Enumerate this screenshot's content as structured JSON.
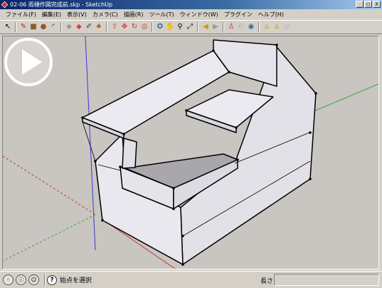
{
  "window": {
    "title": "02-06 雨樋作図完成前.skp - SketchUp",
    "buttons": [
      "_",
      "□",
      "X"
    ]
  },
  "menu": [
    "ファイル(F)",
    "編集(E)",
    "表示(V)",
    "カメラ(C)",
    "描画(R)",
    "ツール(T)",
    "ウィンドウ(W)",
    "プラグイン",
    "ヘルプ(H)"
  ],
  "toolbar": {
    "tools": [
      {
        "name": "select-icon",
        "glyph": "↖"
      },
      {
        "name": "pencil-icon",
        "glyph": "✎"
      },
      {
        "name": "rectangle-icon",
        "glyph": "■"
      },
      {
        "name": "circle-icon",
        "glyph": "●"
      },
      {
        "name": "arc-icon",
        "glyph": "◜"
      },
      {
        "name": "make-component-icon",
        "glyph": "◈"
      },
      {
        "name": "eraser-icon",
        "glyph": "◆"
      },
      {
        "name": "tape-measure-icon",
        "glyph": "✐"
      },
      {
        "name": "paint-bucket-icon",
        "glyph": "♠"
      },
      {
        "name": "push-pull-icon",
        "glyph": "⇧"
      },
      {
        "name": "move-icon",
        "glyph": "✥"
      },
      {
        "name": "rotate-icon",
        "glyph": "↻"
      },
      {
        "name": "offset-icon",
        "glyph": "◎"
      },
      {
        "name": "orbit-icon",
        "glyph": "✪"
      },
      {
        "name": "pan-icon",
        "glyph": "✋"
      },
      {
        "name": "zoom-icon",
        "glyph": "⚲"
      },
      {
        "name": "zoom-extents-icon",
        "glyph": "⤢"
      },
      {
        "name": "previous-view-icon",
        "glyph": "◀"
      },
      {
        "name": "next-view-icon",
        "glyph": "▶"
      },
      {
        "name": "position-camera-icon",
        "glyph": "♙"
      },
      {
        "name": "walk-icon",
        "glyph": "♘"
      },
      {
        "name": "look-around-icon",
        "glyph": "◉"
      },
      {
        "name": "get-models-icon",
        "glyph": "⌂"
      },
      {
        "name": "share-model-icon",
        "glyph": "⌂"
      },
      {
        "name": "google-earth-icon",
        "glyph": "◍"
      }
    ]
  },
  "status": {
    "icons": [
      "geo-location-icon",
      "credits-icon",
      "user-icon"
    ],
    "help_glyph": "?",
    "message": "始点を選択",
    "length_label": "長さ",
    "length_value": ""
  },
  "overlay": {
    "play_button": "play-icon"
  },
  "colors": {
    "face": "#e8e6ee",
    "face_dark": "#d6d4dc",
    "inner_face": "#a9a7ab",
    "axis_green": "#3ea63e",
    "axis_red": "#c43a3a",
    "axis_blue": "#3a3ad0",
    "background": "#c9c5c1"
  }
}
